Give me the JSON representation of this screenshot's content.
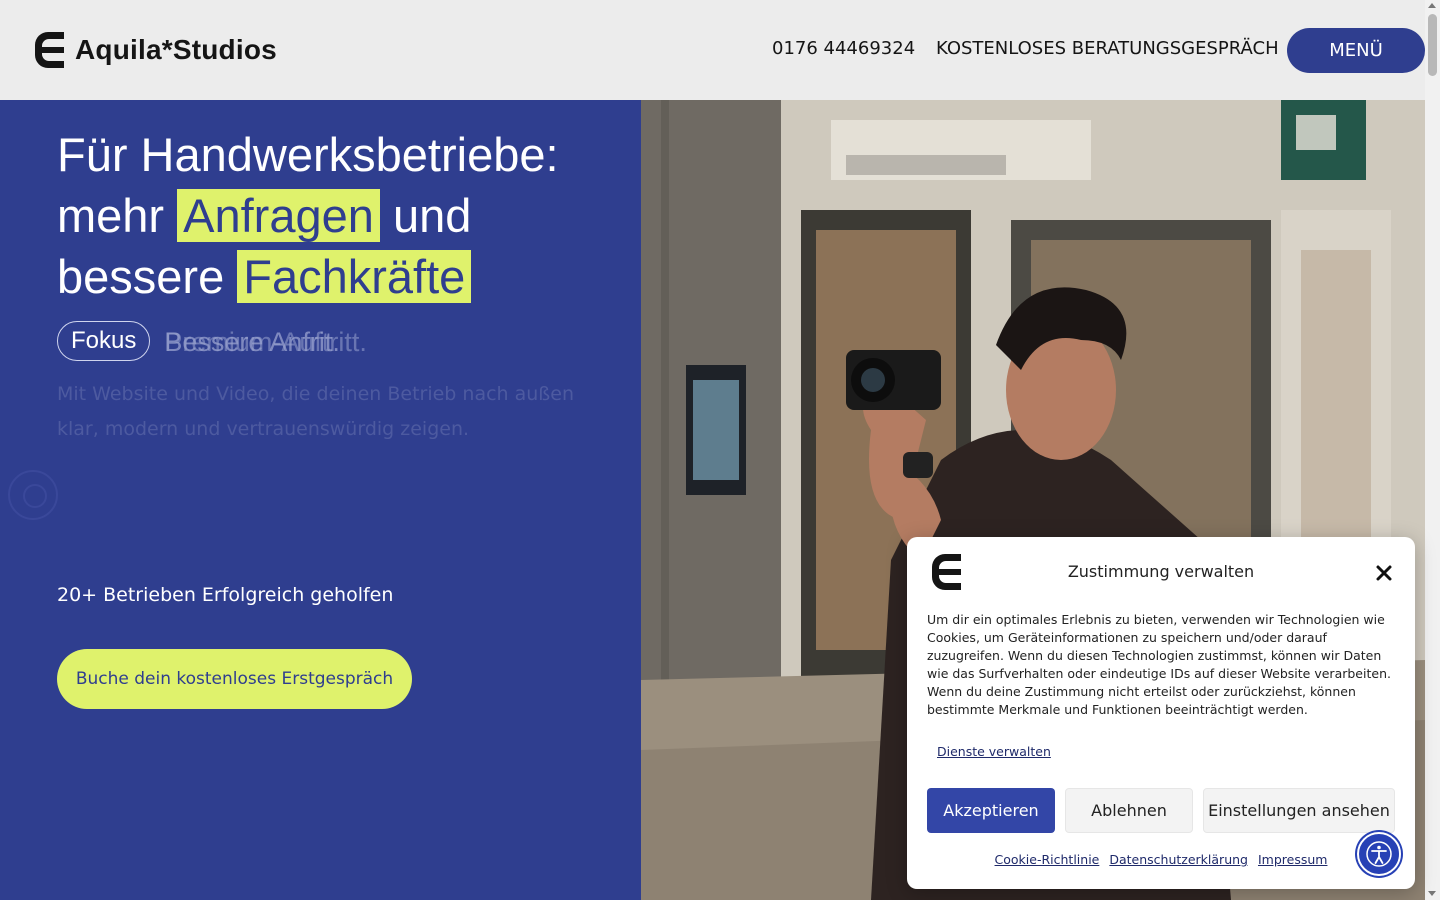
{
  "header": {
    "brand": "Aquila*Studios",
    "phone": "0176 44469324",
    "cta_link": "KOSTENLOSES BERATUNGSGESPRÄCH",
    "menu_label": "MENÜ"
  },
  "hero": {
    "headline_line1": "Für Handwerksbetriebe:",
    "headline_pre2": "mehr ",
    "highlight1": "Anfragen",
    "headline_post2": " und",
    "headline_pre3": "bessere ",
    "highlight2": "Fachkräfte",
    "tag": "Fokus",
    "rotating_a": "Bessere Anfrit.",
    "rotating_b": "Premium-Auftritt.",
    "subtext": "Mit Website und Video, die deinen Betrieb nach außen klar, modern und vertrauenswürdig zeigen.",
    "social_proof": "20+ Betrieben Erfolgreich geholfen",
    "book_button": "Buche dein kostenloses Erstgespräch"
  },
  "cookie": {
    "title": "Zustimmung verwalten",
    "body": "Um dir ein optimales Erlebnis zu bieten, verwenden wir Technologien wie Cookies, um Geräteinformationen zu speichern und/oder darauf zuzugreifen. Wenn du diesen Technologien zustimmst, können wir Daten wie das Surfverhalten oder eindeutige IDs auf dieser Website verarbeiten. Wenn du deine Zustimmung nicht erteilst oder zurückziehst, können bestimmte Merkmale und Funktionen beeinträchtigt werden.",
    "manage_services": "Dienste verwalten",
    "accept": "Akzeptieren",
    "deny": "Ablehnen",
    "settings": "Einstellungen ansehen",
    "footer_links": [
      "Cookie-Richtlinie",
      "Datenschutzerklärung",
      "Impressum"
    ]
  },
  "colors": {
    "brand_blue": "#2f3e8f",
    "highlight_lime": "#dff26c",
    "accept_blue": "#3346a7"
  },
  "icons": [
    "logo-mark-icon",
    "close-icon",
    "accessibility-icon"
  ]
}
